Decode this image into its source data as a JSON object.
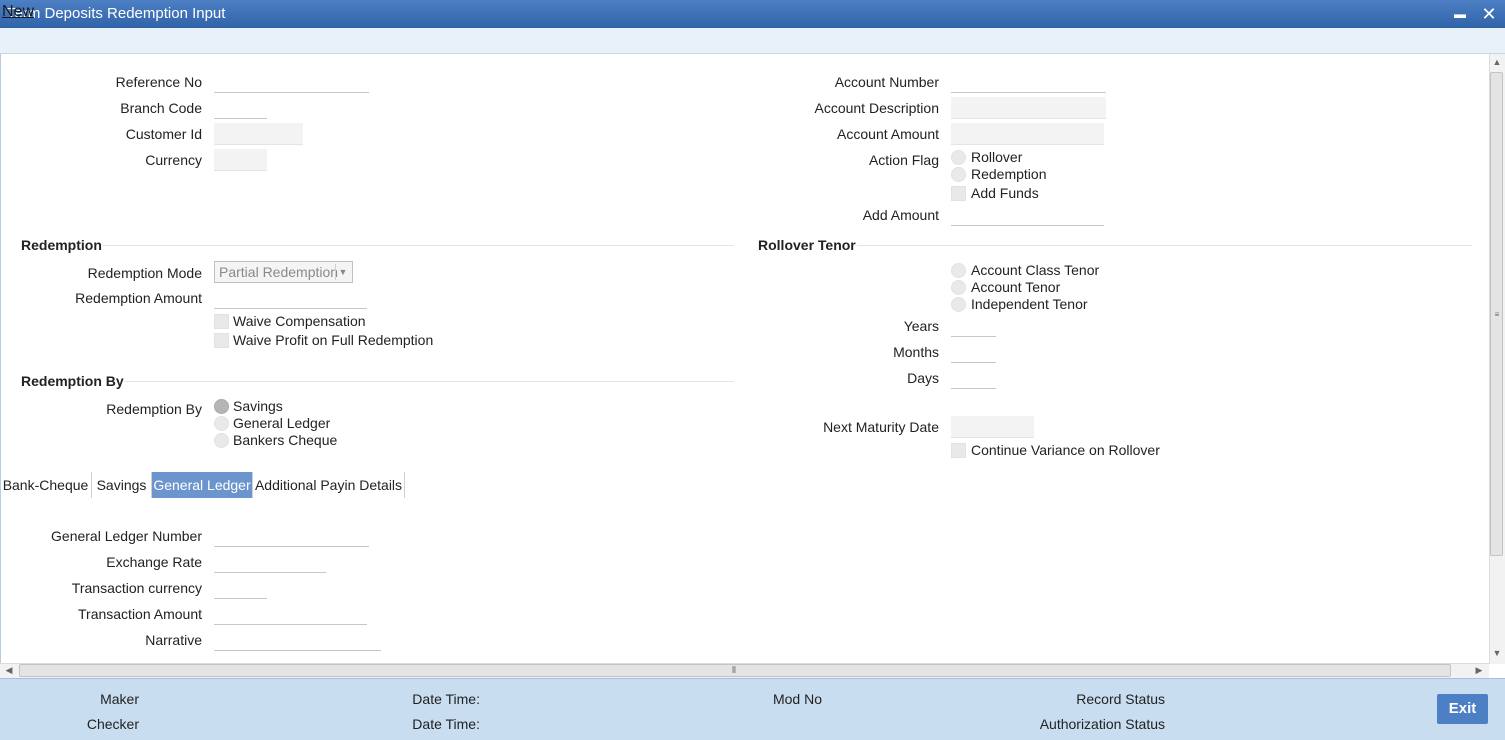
{
  "window": {
    "title": "Term Deposits Redemption Input",
    "minimize_glyph": "▬",
    "close_glyph": "✕"
  },
  "toolbar": {
    "new_label": "New"
  },
  "header_left": {
    "reference_no": "Reference No",
    "branch_code": "Branch Code",
    "customer_id": "Customer Id",
    "currency": "Currency"
  },
  "header_right": {
    "account_number": "Account Number",
    "account_description": "Account Description",
    "account_amount": "Account Amount",
    "action_flag": "Action Flag",
    "action_options": [
      "Rollover",
      "Redemption"
    ],
    "add_funds": "Add Funds",
    "add_amount": "Add Amount"
  },
  "redemption": {
    "title": "Redemption",
    "mode_label": "Redemption Mode",
    "mode_value": "Partial Redemption",
    "amount_label": "Redemption Amount",
    "waive_compensation": "Waive Compensation",
    "waive_profit": "Waive Profit on Full Redemption"
  },
  "redemption_by": {
    "title": "Redemption By",
    "label": "Redemption By",
    "options": [
      "Savings",
      "General Ledger",
      "Bankers Cheque"
    ],
    "selected": "Savings"
  },
  "rollover_tenor": {
    "title": "Rollover Tenor",
    "options": [
      "Account Class Tenor",
      "Account Tenor",
      "Independent Tenor"
    ],
    "years": "Years",
    "months": "Months",
    "days": "Days",
    "next_maturity_date": "Next Maturity Date",
    "continue_variance": "Continue Variance on Rollover"
  },
  "tabs": [
    {
      "label": "Bank-Cheque"
    },
    {
      "label": "Savings"
    },
    {
      "label": "General Ledger"
    },
    {
      "label": "Additional Payin Details"
    }
  ],
  "active_tab": "General Ledger",
  "general_ledger": {
    "gl_number": "General Ledger Number",
    "exchange_rate": "Exchange Rate",
    "transaction_currency": "Transaction currency",
    "transaction_amount": "Transaction Amount",
    "narrative": "Narrative"
  },
  "footer": {
    "maker": "Maker",
    "checker": "Checker",
    "date_time_1": "Date Time:",
    "date_time_2": "Date Time:",
    "mod_no": "Mod No",
    "record_status": "Record Status",
    "authorization_status": "Authorization Status",
    "exit_label": "Exit"
  },
  "colors": {
    "title_bar": "#2f63a8",
    "active_tab": "#6b95cc",
    "footer_bg": "#c8ddf0",
    "exit_button": "#4d7fc4"
  }
}
